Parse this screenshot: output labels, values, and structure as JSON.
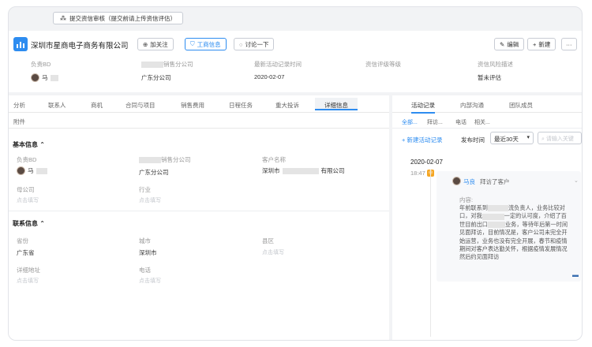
{
  "topbar": {
    "submit_label": "提交资信审核（提交前请上传资信评估）"
  },
  "header": {
    "company": "深圳市星商电子商务有限公司",
    "buttons": {
      "follow": "加关注",
      "business": "工商信息",
      "discuss": "讨论一下",
      "edit": "编辑",
      "new": "新建",
      "more": "···"
    },
    "meta": [
      {
        "label": "负责BD",
        "value": "马"
      },
      {
        "label": "销售分公司",
        "value": "广东分公司"
      },
      {
        "label": "最新活动记录时间",
        "value": "2020-02-07"
      },
      {
        "label": "资信评级等级",
        "value": ""
      },
      {
        "label": "资信风险描述",
        "value": "暂未评估"
      }
    ]
  },
  "tabs_left": [
    "分析",
    "联系人",
    "商机",
    "合同与项目",
    "销售费用",
    "日程任务",
    "重大投诉",
    "详细信息"
  ],
  "tabs_left_row2": [
    "附件"
  ],
  "basic": {
    "title": "基本信息",
    "fields": [
      {
        "label": "负责BD",
        "value": "马"
      },
      {
        "label": "销售分公司",
        "value": "广东分公司"
      },
      {
        "label": "客户名称",
        "value": "深圳市",
        "suffix": "有限公司"
      },
      {
        "label": "母公司",
        "value": "点击填写"
      },
      {
        "label": "行业",
        "value": "点击填写"
      }
    ]
  },
  "contact": {
    "title": "联系信息",
    "fields": [
      {
        "label": "省份",
        "value": "广东省"
      },
      {
        "label": "城市",
        "value": "深圳市"
      },
      {
        "label": "县区",
        "value": "点击填写"
      },
      {
        "label": "详细地址",
        "value": "点击填写"
      },
      {
        "label": "电话",
        "value": "点击填写"
      }
    ]
  },
  "right": {
    "tabs": [
      "活动记录",
      "内部沟通",
      "团队成员"
    ],
    "subtabs": [
      "全部...",
      "拜访...",
      "电话",
      "相关..."
    ],
    "new_activity": "新建活动记录",
    "publish_label": "发布时间",
    "period": "最近30天",
    "search_placeholder": "请输入关键",
    "date": "2020-02-07",
    "time": "18:47",
    "author": "马良",
    "action": "拜访了客户",
    "content_label": "内容:",
    "content_lines": [
      "年前联系到",
      "流负责人，业务比较对",
      "口，对我",
      "一定的认可度，介绍了百",
      "世目前出口",
      "业务，等待年后第一时间",
      "见面拜访，目前情况是，客户公司未完全开",
      "始运营，业务也没有完全开展，春节和疫情",
      "期间对客户表达勤关怀，根据疫情发展情况",
      "然后约见面拜访"
    ]
  },
  "colors": {
    "accent": "#2d8cf0"
  }
}
